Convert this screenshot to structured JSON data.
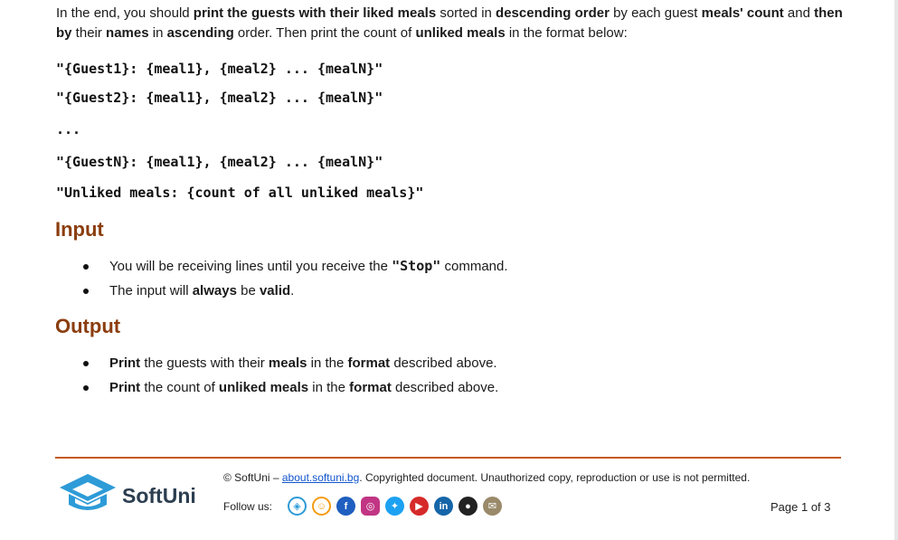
{
  "intro": {
    "p1": "In the end, you should ",
    "b1": "print the guests with their liked meals",
    "p2": " sorted in ",
    "b2": "descending order",
    "p3": " by each guest ",
    "b3": "meals' count",
    "p4": " and ",
    "b4": "then by",
    "p5": " their ",
    "b5": "names",
    "p6": " in ",
    "b6": "ascending",
    "p7": " order. Then print the count of ",
    "b7": "unliked meals",
    "p8": " in the format below:"
  },
  "code_lines": [
    "\"{Guest1}: {meal1}, {meal2} ... {mealN}\"",
    "\"{Guest2}: {meal1}, {meal2} ... {mealN}\"",
    "...",
    "\"{GuestN}: {meal1}, {meal2} ... {mealN}\"",
    "\"Unliked meals: {count of all unliked meals}\""
  ],
  "input": {
    "heading": "Input",
    "items": [
      {
        "a": "You will be receiving lines until you receive the ",
        "code": "\"Stop\"",
        "b": " command."
      },
      {
        "a": "The input will ",
        "bold1": "always",
        "b": " be ",
        "bold2": "valid",
        "c": "."
      }
    ]
  },
  "output": {
    "heading": "Output",
    "items": [
      {
        "bold1": "Print",
        "a": " the guests with their ",
        "bold2": "meals",
        "b": " in the ",
        "bold3": "format",
        "c": " described above."
      },
      {
        "bold1": "Print",
        "a": " the count of ",
        "bold2": "unliked meals",
        "b": " in the ",
        "bold3": "format",
        "c": " described above."
      }
    ]
  },
  "footer": {
    "logo_text": "SoftUni",
    "copyright_prefix": "© SoftUni – ",
    "link_text": "about.softuni.bg",
    "copyright_suffix": ". Copyrighted document. Unauthorized copy, reproduction or use is not permitted.",
    "follow_label": "Follow us:",
    "page_label": "Page 1 of 3",
    "social_icons": [
      "softuni-icon",
      "softuni-kids-icon",
      "facebook-icon",
      "instagram-icon",
      "twitter-icon",
      "youtube-icon",
      "linkedin-icon",
      "github-icon",
      "email-icon"
    ],
    "colors": {
      "rule": "#c55a11",
      "heading": "#8b3d0e",
      "link": "#1155cc",
      "logo": "#2d9bd7"
    }
  }
}
